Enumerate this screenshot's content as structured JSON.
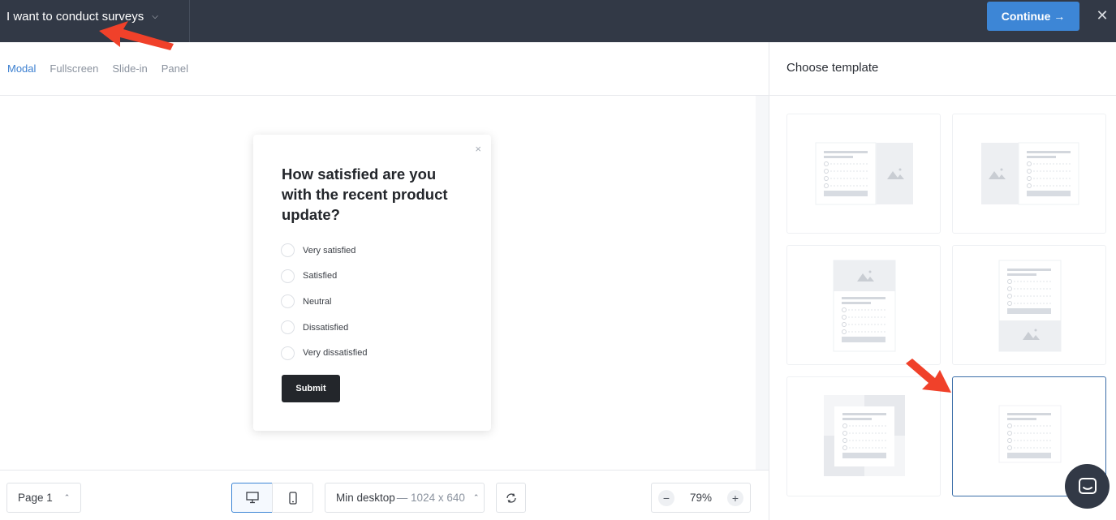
{
  "topbar": {
    "goal_label": "I want to conduct surveys",
    "continue_label": "Continue →",
    "close_glyph": "✕"
  },
  "tabs": [
    {
      "label": "Modal",
      "active": true
    },
    {
      "label": "Fullscreen",
      "active": false
    },
    {
      "label": "Slide-in",
      "active": false
    },
    {
      "label": "Panel",
      "active": false
    }
  ],
  "survey": {
    "question": "How satisfied are you with the recent product update?",
    "options": [
      "Very satisfied",
      "Satisfied",
      "Neutral",
      "Dissatisfied",
      "Very dissatisfied"
    ],
    "submit_label": "Submit",
    "close_glyph": "×"
  },
  "bottombar": {
    "page_label": "Page 1",
    "size_label": "Min desktop",
    "size_dims": "— 1024 x 640",
    "zoom_value": "79%",
    "zoom_minus": "−",
    "zoom_plus": "+"
  },
  "right_panel": {
    "title": "Choose template",
    "selected_template_index": 5
  },
  "colors": {
    "topbar_bg": "#323946",
    "accent_blue": "#3d86d6",
    "annotation_red": "#f0412a"
  }
}
